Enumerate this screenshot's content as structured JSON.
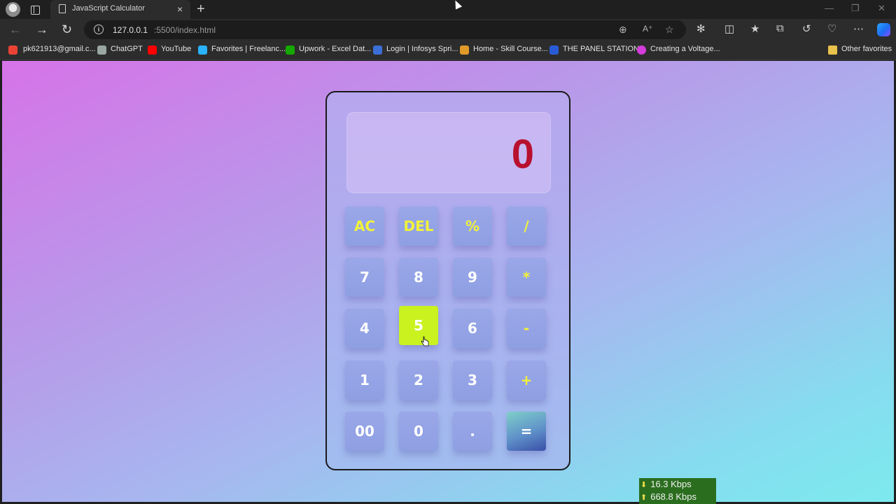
{
  "browser": {
    "tab": {
      "title": "JavaScript Calculator",
      "close_glyph": "×"
    },
    "new_tab_glyph": "+",
    "address": {
      "host": "127.0.0.1",
      "path": ":5500/index.html"
    },
    "window_controls": {
      "minimize": "—",
      "maximize": "❐",
      "close": "✕"
    }
  },
  "bookmarks": [
    {
      "label": "pk621913@gmail.c...",
      "icon": "gmail-icon",
      "color": "#ea4335"
    },
    {
      "label": "ChatGPT",
      "icon": "chatgpt-icon",
      "color": "#9aa6a2"
    },
    {
      "label": "YouTube",
      "icon": "youtube-icon",
      "color": "#ff0000"
    },
    {
      "label": "Favorites | Freelanc...",
      "icon": "freelancer-icon",
      "color": "#29b2fe"
    },
    {
      "label": "Upwork - Excel Dat...",
      "icon": "upwork-icon",
      "color": "#14a800"
    },
    {
      "label": "Login | Infosys Spri...",
      "icon": "infosys-icon",
      "color": "#3b6fd6"
    },
    {
      "label": "Home - Skill Course...",
      "icon": "skill-icon",
      "color": "#e09a2a"
    },
    {
      "label": "THE PANEL STATION",
      "icon": "panel-station-icon",
      "color": "#2a5bd7"
    },
    {
      "label": "Creating a Voltage...",
      "icon": "voltage-icon",
      "color": "#d43cdc"
    }
  ],
  "other_favorites": "Other favorites",
  "calculator": {
    "display": "0",
    "keys": [
      [
        "AC",
        "DEL",
        "%",
        "/"
      ],
      [
        "7",
        "8",
        "9",
        "*"
      ],
      [
        "4",
        "5",
        "6",
        "-"
      ],
      [
        "1",
        "2",
        "3",
        "+"
      ],
      [
        "00",
        "0",
        ".",
        "="
      ]
    ],
    "active_key": "5"
  },
  "netspeed": {
    "down": "16.3 Kbps",
    "up": "668.8 Kbps"
  }
}
